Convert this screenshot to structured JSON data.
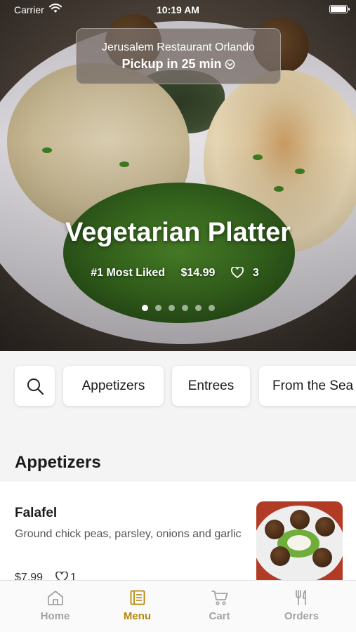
{
  "status_bar": {
    "carrier": "Carrier",
    "time": "10:19 AM"
  },
  "restaurant": {
    "name": "Jerusalem Restaurant Orlando",
    "pickup": "Pickup in 25 min"
  },
  "featured": {
    "title": "Vegetarian Platter",
    "rank": "#1 Most Liked",
    "price": "$14.99",
    "likes": "3",
    "pages": 6,
    "active_page": 1
  },
  "categories": {
    "search_icon": "search-icon",
    "items": [
      "Appetizers",
      "Entrees",
      "From the Sea"
    ]
  },
  "section": {
    "title": "Appetizers"
  },
  "menu_items": [
    {
      "name": "Falafel",
      "description": "Ground chick peas, parsley, onions and garlic",
      "price": "$7.99",
      "likes": "1"
    }
  ],
  "tab_bar": {
    "active": "Menu",
    "active_color": "#b8860b",
    "tabs": [
      {
        "label": "Home",
        "icon": "home-icon"
      },
      {
        "label": "Menu",
        "icon": "menu-book-icon"
      },
      {
        "label": "Cart",
        "icon": "cart-icon"
      },
      {
        "label": "Orders",
        "icon": "utensils-icon"
      }
    ]
  }
}
